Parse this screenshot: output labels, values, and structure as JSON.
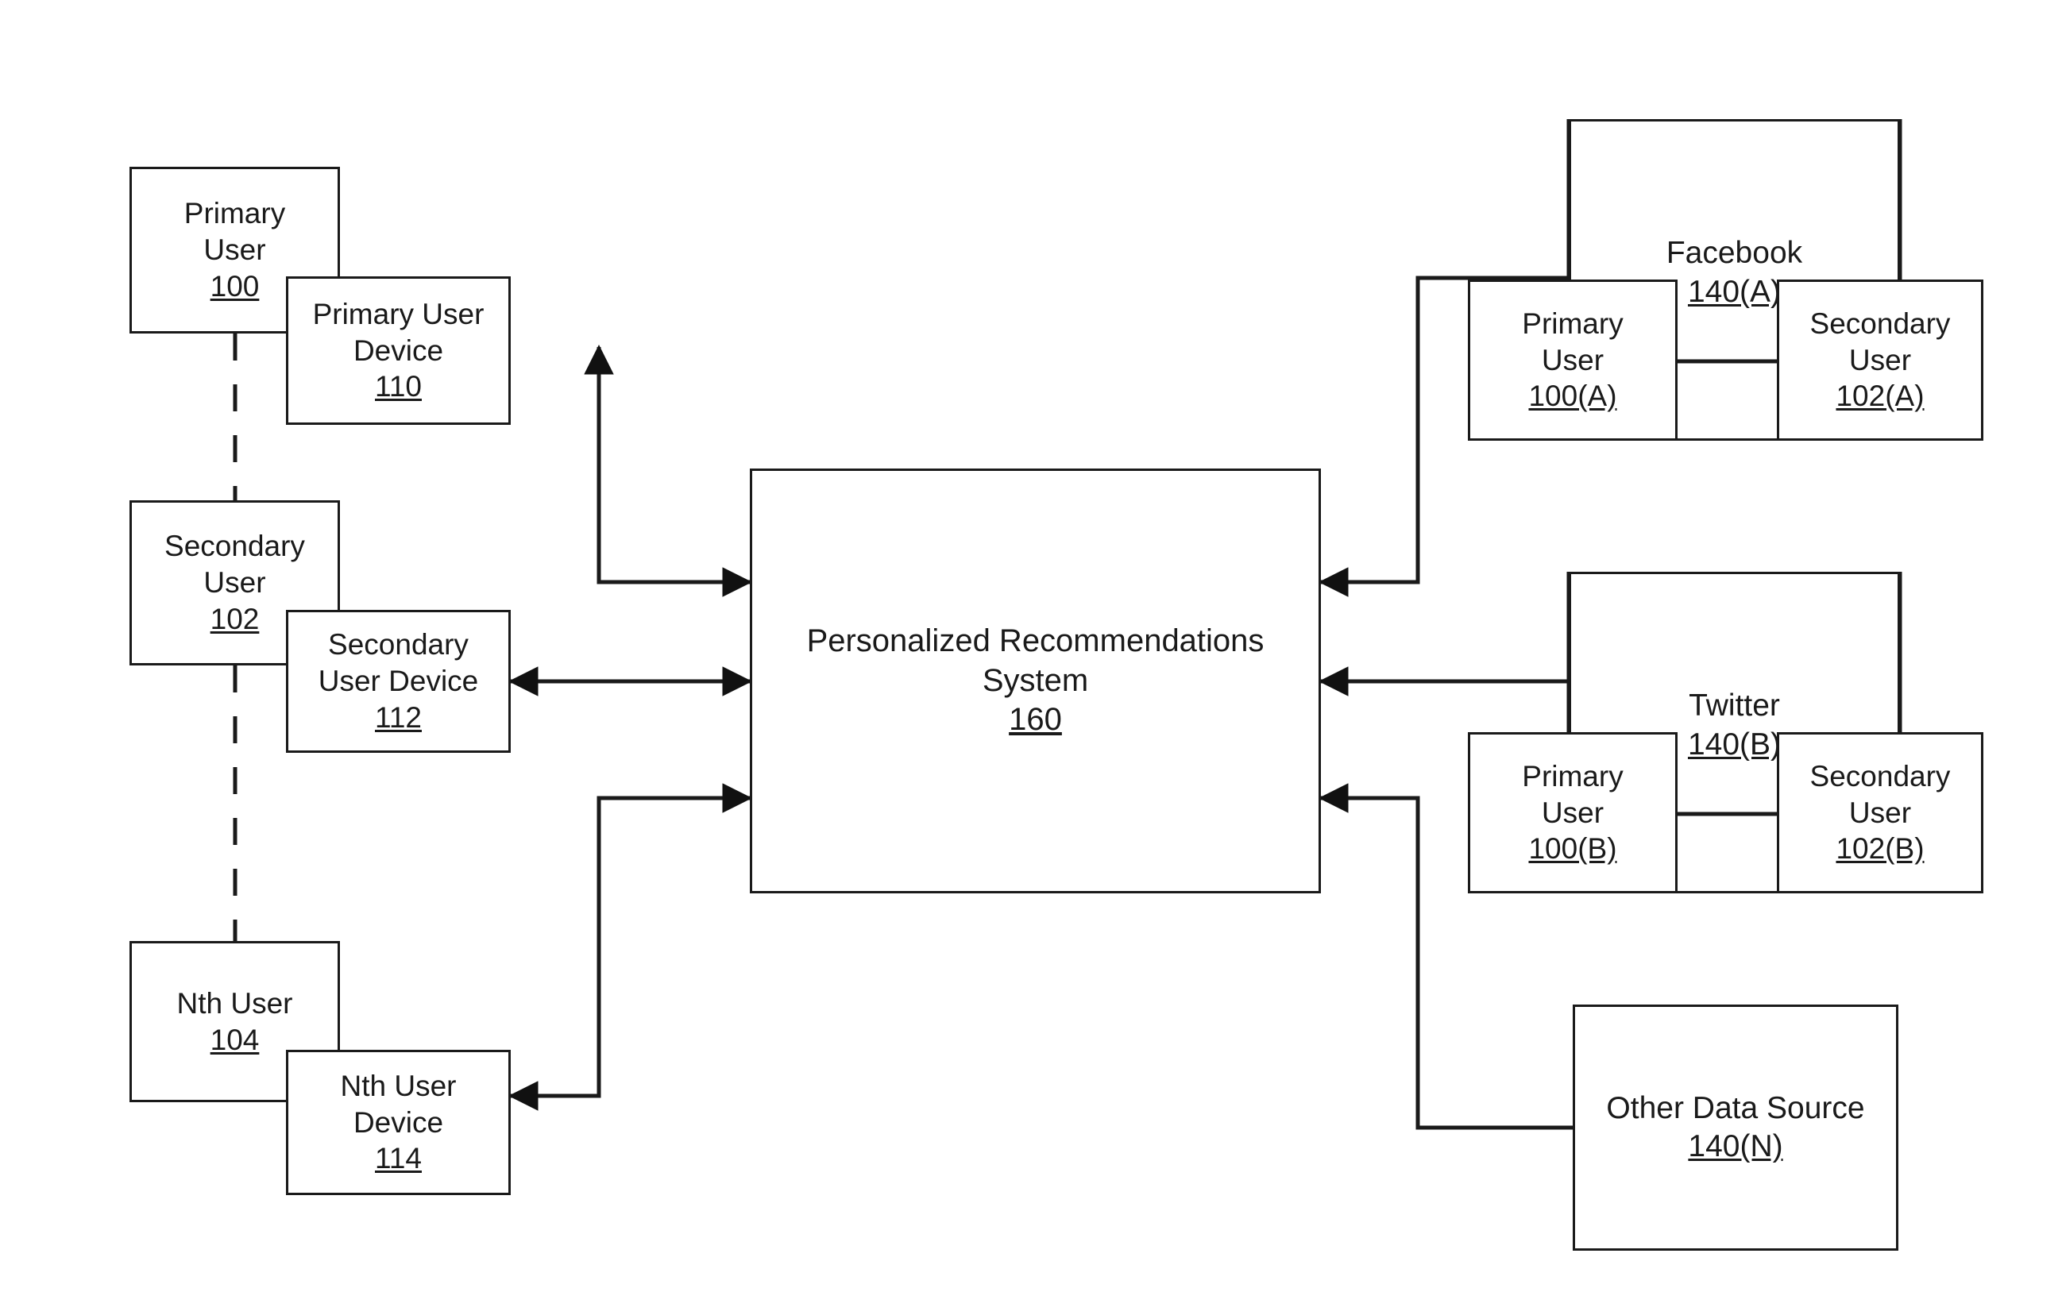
{
  "figure": {
    "title": "Personalized Recommendations System block diagram",
    "stroke_color": "#1a1a1a",
    "background_color": "#ffffff"
  },
  "users": [
    {
      "label": "Primary\nUser",
      "ref": "100"
    },
    {
      "label": "Secondary\nUser",
      "ref": "102"
    },
    {
      "label": "Nth User",
      "ref": "104"
    }
  ],
  "devices": [
    {
      "label": "Primary User\nDevice",
      "ref": "110"
    },
    {
      "label": "Secondary\nUser Device",
      "ref": "112"
    },
    {
      "label": "Nth User\nDevice",
      "ref": "114"
    }
  ],
  "system": {
    "label": "Personalized Recommendations\nSystem",
    "ref": "160"
  },
  "sources": [
    {
      "label": "Facebook",
      "ref": "140(A)",
      "members": [
        {
          "label": "Primary\nUser",
          "ref": "100(A)"
        },
        {
          "label": "Secondary\nUser",
          "ref": "102(A)"
        }
      ]
    },
    {
      "label": "Twitter",
      "ref": "140(B)",
      "members": [
        {
          "label": "Primary\nUser",
          "ref": "100(B)"
        },
        {
          "label": "Secondary\nUser",
          "ref": "102(B)"
        }
      ]
    },
    {
      "label": "Other Data Source",
      "ref": "140(N)",
      "members": []
    }
  ]
}
